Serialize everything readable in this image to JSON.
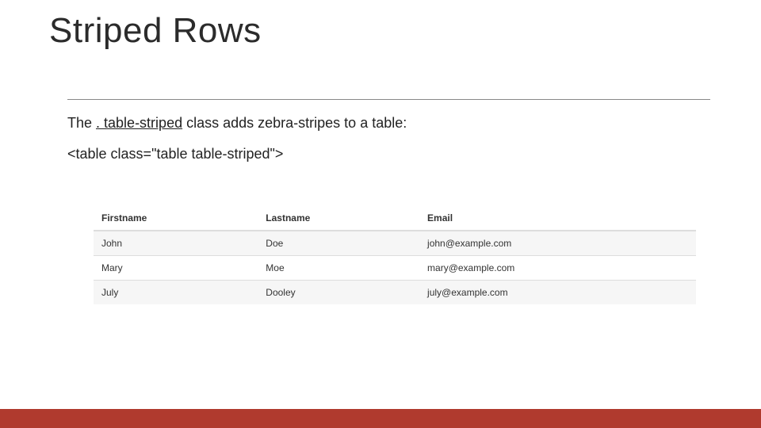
{
  "title": "Striped Rows",
  "description": {
    "pre": "The ",
    "class_name": ". table-striped",
    "post": " class adds zebra-stripes to a table:"
  },
  "code_line": "<table class=\"table table-striped\">",
  "table": {
    "headers": [
      "Firstname",
      "Lastname",
      "Email"
    ],
    "rows": [
      [
        "John",
        "Doe",
        "john@example.com"
      ],
      [
        "Mary",
        "Moe",
        "mary@example.com"
      ],
      [
        "July",
        "Dooley",
        "july@example.com"
      ]
    ]
  },
  "chart_data": {
    "type": "table",
    "headers": [
      "Firstname",
      "Lastname",
      "Email"
    ],
    "rows": [
      [
        "John",
        "Doe",
        "john@example.com"
      ],
      [
        "Mary",
        "Moe",
        "mary@example.com"
      ],
      [
        "July",
        "Dooley",
        "july@example.com"
      ]
    ],
    "title": "Striped Rows"
  }
}
